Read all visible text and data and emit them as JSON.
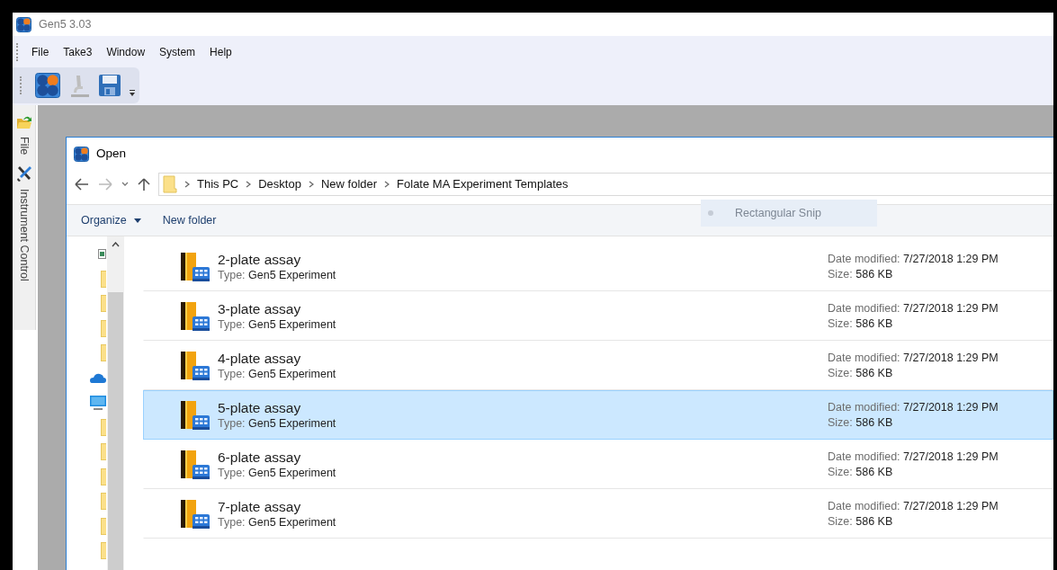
{
  "app": {
    "title": "Gen5 3.03"
  },
  "menu": [
    {
      "label": "File"
    },
    {
      "label": "Take3"
    },
    {
      "label": "Window"
    },
    {
      "label": "System"
    },
    {
      "label": "Help"
    }
  ],
  "side_tabs": [
    {
      "label": "File",
      "kind": "file"
    },
    {
      "label": "Instrument Control",
      "kind": "instrument"
    }
  ],
  "dialog": {
    "title": "Open",
    "breadcrumb": [
      "This PC",
      "Desktop",
      "New folder",
      "Folate MA Experiment Templates"
    ],
    "commands": [
      {
        "label": "Organize",
        "dropdown": true
      },
      {
        "label": "New folder",
        "dropdown": false
      }
    ],
    "snip_overlay": {
      "label": "Rectangular Snip"
    },
    "nav_items": [
      {
        "kind": "picture"
      },
      {
        "kind": "folder"
      },
      {
        "kind": "folder"
      },
      {
        "kind": "folder"
      },
      {
        "kind": "folder"
      },
      {
        "kind": "cloud"
      },
      {
        "kind": "pc"
      },
      {
        "kind": "folder"
      },
      {
        "kind": "folder"
      },
      {
        "kind": "folder"
      },
      {
        "kind": "folder"
      },
      {
        "kind": "folder"
      },
      {
        "kind": "folder"
      }
    ],
    "files": [
      {
        "name": "2-plate assay",
        "type_label": "Type:",
        "type": "Gen5 Experiment",
        "date_label": "Date modified:",
        "date": "7/27/2018 1:29 PM",
        "size_label": "Size:",
        "size": "586 KB",
        "selected": false
      },
      {
        "name": "3-plate assay",
        "type_label": "Type:",
        "type": "Gen5 Experiment",
        "date_label": "Date modified:",
        "date": "7/27/2018 1:29 PM",
        "size_label": "Size:",
        "size": "586 KB",
        "selected": false
      },
      {
        "name": "4-plate assay",
        "type_label": "Type:",
        "type": "Gen5 Experiment",
        "date_label": "Date modified:",
        "date": "7/27/2018 1:29 PM",
        "size_label": "Size:",
        "size": "586 KB",
        "selected": false
      },
      {
        "name": "5-plate assay",
        "type_label": "Type:",
        "type": "Gen5 Experiment",
        "date_label": "Date modified:",
        "date": "7/27/2018 1:29 PM",
        "size_label": "Size:",
        "size": "586 KB",
        "selected": true
      },
      {
        "name": "6-plate assay",
        "type_label": "Type:",
        "type": "Gen5 Experiment",
        "date_label": "Date modified:",
        "date": "7/27/2018 1:29 PM",
        "size_label": "Size:",
        "size": "586 KB",
        "selected": false
      },
      {
        "name": "7-plate assay",
        "type_label": "Type:",
        "type": "Gen5 Experiment",
        "date_label": "Date modified:",
        "date": "7/27/2018 1:29 PM",
        "size_label": "Size:",
        "size": "586 KB",
        "selected": false
      }
    ]
  }
}
